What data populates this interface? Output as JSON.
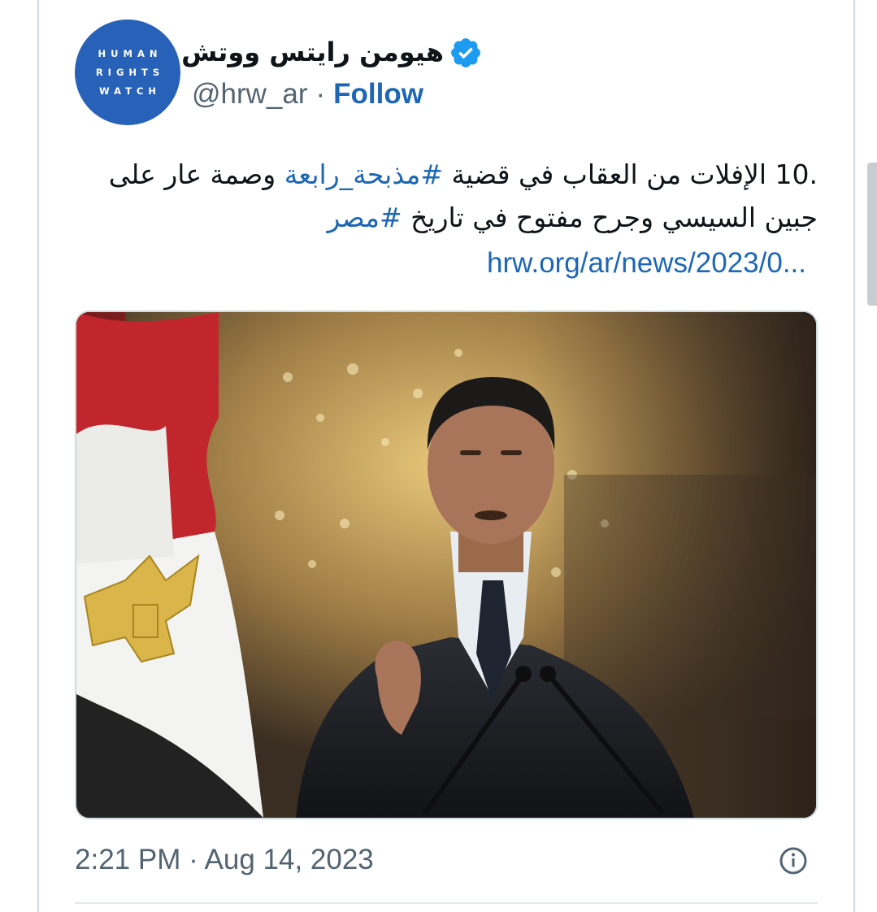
{
  "author": {
    "avatar_lines": [
      "HUMAN",
      "RIGHTS",
      "WATCH"
    ],
    "display_name": "هيومن رايتس ووتش",
    "verified_icon": "verified-badge-icon",
    "handle": "@hrw_ar",
    "separator": "·",
    "follow_label": "Follow"
  },
  "tweet": {
    "num": "10.",
    "text_part1": " الإفلات من العقاب في قضية ",
    "hashtag1": "#مذبحة_رابعة",
    "text_part2": " وصمة عار على جبين السيسي وجرح مفتوح في تاريخ ",
    "hashtag2": "#مصر",
    "link": "hrw.org/ar/news/2023/0..."
  },
  "meta": {
    "timestamp": "2:21 PM · Aug 14, 2023",
    "info_icon": "info-icon"
  },
  "colors": {
    "accent": "#1d67b5",
    "avatar_bg": "#2761b8",
    "muted": "#536471",
    "border": "#cfd9de"
  }
}
